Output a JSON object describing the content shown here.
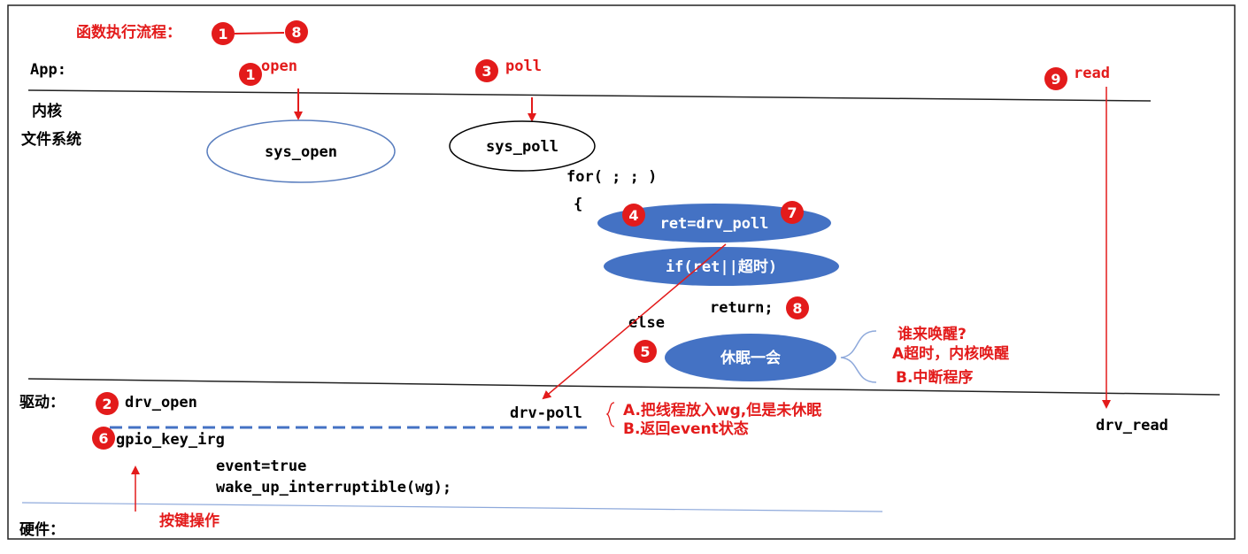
{
  "legend": {
    "label": "函数执行流程：",
    "from": "1",
    "to": "8"
  },
  "layers": {
    "app": "App:",
    "kernel": "内核",
    "fs": "文件系统",
    "driver": "驱动：",
    "hardware": "硬件："
  },
  "steps": {
    "open": {
      "num": "1",
      "label": "open"
    },
    "poll": {
      "num": "3",
      "label": "poll"
    },
    "read": {
      "num": "9",
      "label": "read"
    },
    "drv_open": {
      "num": "2",
      "label": "drv_open"
    },
    "gpio": {
      "num": "6",
      "label": "gpio_key_irg"
    },
    "drv_poll_call": {
      "num": "4",
      "num2": "7",
      "label": "ret=drv_poll"
    },
    "sleep": {
      "num": "5",
      "label": "休眠一会"
    },
    "return": {
      "num": "8",
      "label": "return;"
    }
  },
  "kernel_nodes": {
    "sys_open": "sys_open",
    "sys_poll": "sys_poll",
    "for_loop": "for( ; ; )",
    "brace": "{",
    "if_cond": "if(ret||超时)",
    "else_label": "else"
  },
  "wake_note": {
    "title": "谁来唤醒?",
    "a": "A超时，内核唤醒",
    "b": "B.中断程序"
  },
  "driver_nodes": {
    "drv_poll": "drv-poll",
    "note_a": "A.把线程放入wg,但是未休眠",
    "note_b": "B.返回event状态",
    "drv_read": "drv_read",
    "event_true": "event=true",
    "wake_up": "wake_up_interruptible(wg);",
    "key_op": "按键操作"
  },
  "colors": {
    "accent": "#e31b1b",
    "ellipse_blue": "#4472c4",
    "outline_blue": "#5b7fbf",
    "dash_blue": "#4472c4",
    "text": "#000000"
  }
}
